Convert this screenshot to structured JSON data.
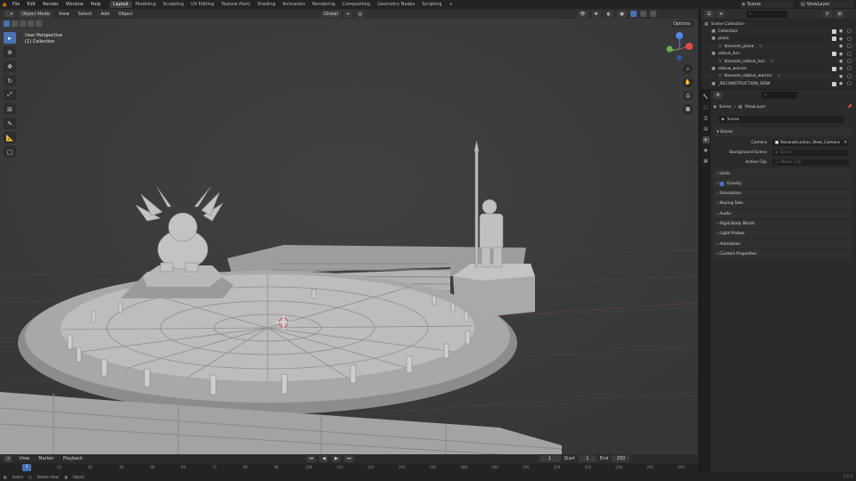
{
  "topbar": {
    "menus": [
      "File",
      "Edit",
      "Render",
      "Window",
      "Help"
    ],
    "workspaces": [
      {
        "label": "Layout",
        "active": true
      },
      {
        "label": "Modeling",
        "active": false
      },
      {
        "label": "Sculpting",
        "active": false
      },
      {
        "label": "UV Editing",
        "active": false
      },
      {
        "label": "Texture Paint",
        "active": false
      },
      {
        "label": "Shading",
        "active": false
      },
      {
        "label": "Animation",
        "active": false
      },
      {
        "label": "Rendering",
        "active": false
      },
      {
        "label": "Compositing",
        "active": false
      },
      {
        "label": "Geometry Nodes",
        "active": false
      },
      {
        "label": "Scripting",
        "active": false
      }
    ],
    "scene": "Scene",
    "view_layer": "ViewLayer"
  },
  "viewport": {
    "mode": "Object Mode",
    "menus": [
      "View",
      "Select",
      "Add",
      "Object"
    ],
    "transform": "Global",
    "options": "Options",
    "overlay_line1": "User Perspective",
    "overlay_line2": "(1) Collection",
    "background": "#3c3c3c"
  },
  "timeline": {
    "menus": [
      "View",
      "Marker",
      "Playback"
    ],
    "current_frame": "1",
    "start_label": "Start",
    "start": "1",
    "end_label": "End",
    "end": "250",
    "cursor": "1",
    "ticks": [
      "1",
      "12",
      "24",
      "36",
      "48",
      "60",
      "72",
      "84",
      "96",
      "108",
      "120",
      "132",
      "144",
      "156",
      "168",
      "180",
      "192",
      "204",
      "216",
      "228",
      "240",
      "250"
    ]
  },
  "statusbar": {
    "items": [
      "Select",
      "Rotate View",
      "Object"
    ],
    "version": "3.1.2"
  },
  "outliner": {
    "search_placeholder": "",
    "rows": [
      {
        "label": "Scene Collection",
        "indent": 0
      },
      {
        "label": "Collection",
        "indent": 1
      },
      {
        "label": "plaza",
        "indent": 1
      },
      {
        "label": "blossom_plaza",
        "indent": 2
      },
      {
        "label": "statue_lion",
        "indent": 1
      },
      {
        "label": "blossom_statue_lion",
        "indent": 2
      },
      {
        "label": "statue_warrior",
        "indent": 1
      },
      {
        "label": "blossom_statue_warrior",
        "indent": 2
      },
      {
        "label": "_RECONSTRUCTION_VIEW",
        "indent": 1
      }
    ]
  },
  "properties": {
    "breadcrumb_scene": "Scene",
    "breadcrumb_layer": "ViewLayer",
    "datablock": "Scene",
    "panel_title": "Scene",
    "camera_label": "Camera",
    "camera_value": "Reconstruction_View_Camera",
    "bg_scene_label": "Background Scene",
    "bg_scene_value": "Scene",
    "active_clip_label": "Active Clip",
    "active_clip_value": "Movie Clip",
    "sections": [
      "Units",
      "Gravity",
      "Simulation",
      "Keying Sets",
      "Audio",
      "Rigid Body World",
      "Light Probes",
      "Animation",
      "Custom Properties"
    ]
  },
  "colors": {
    "accent": "#4772b3",
    "logo": "#e87d0d",
    "mesh": "#b4b4b4"
  }
}
